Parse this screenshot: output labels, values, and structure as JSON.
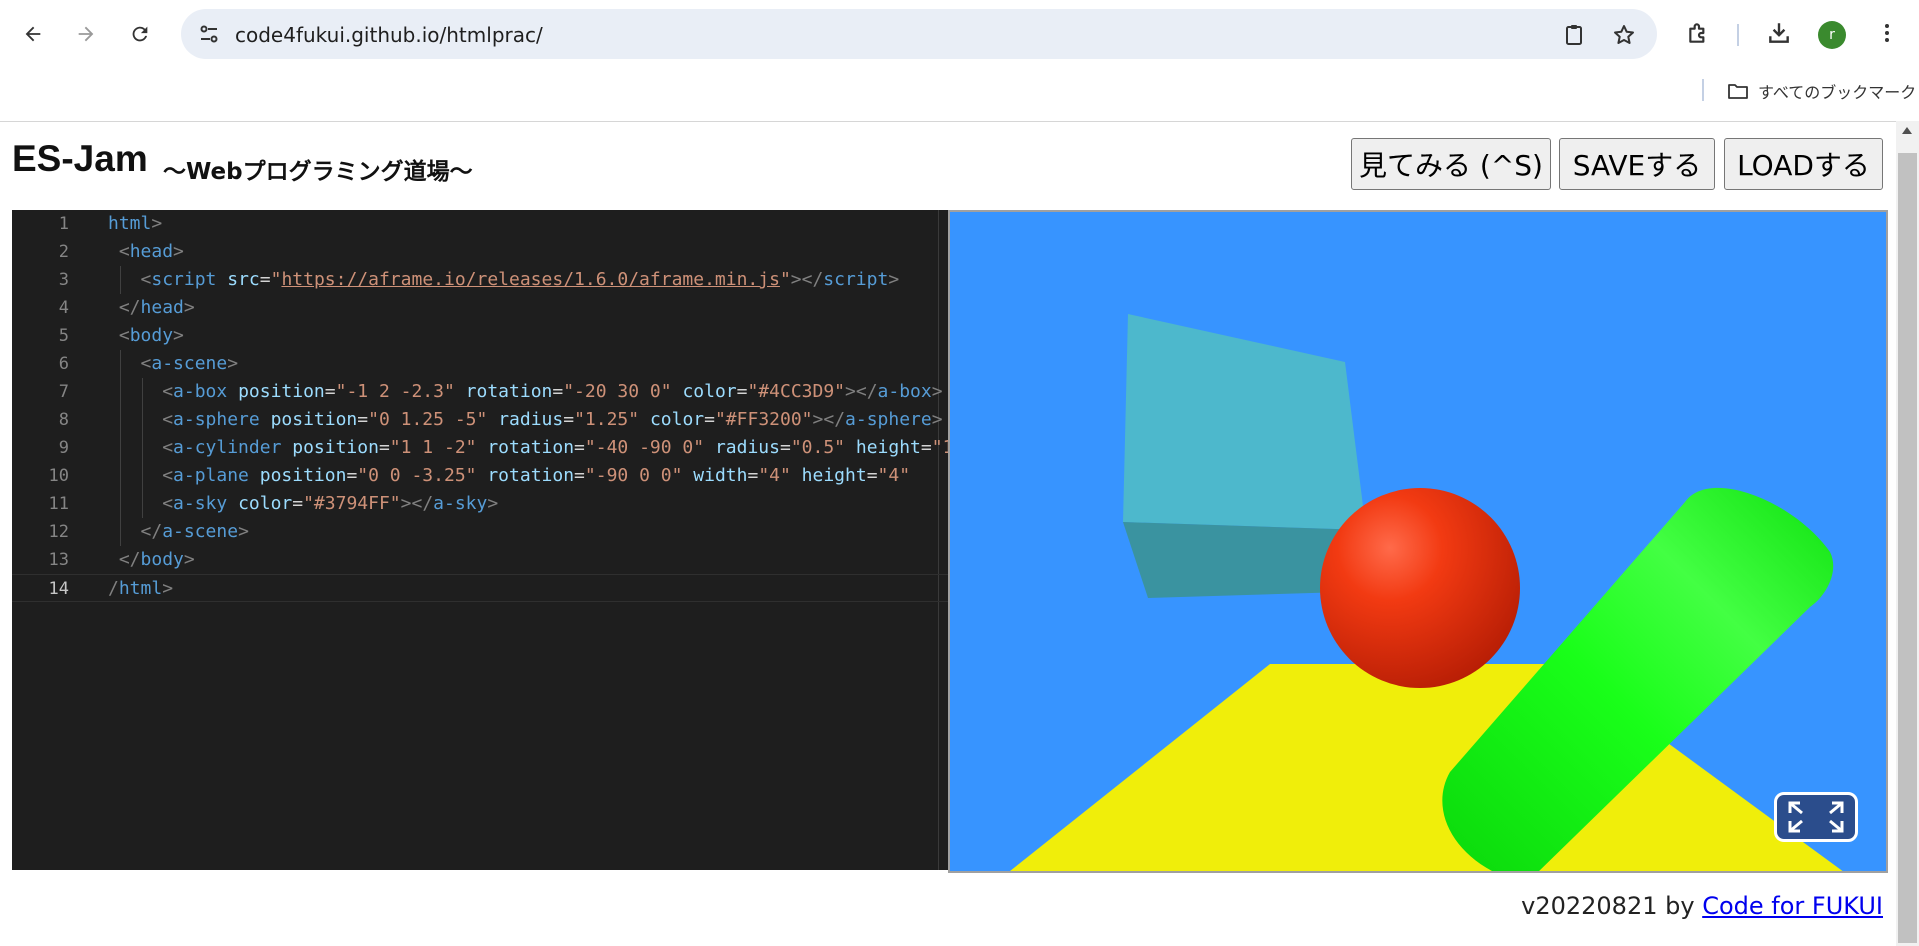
{
  "browser": {
    "url": "code4fukui.github.io/htmlprac/",
    "avatar_letter": "r",
    "bookmarks_all_label": "すべてのブックマーク"
  },
  "page": {
    "title": "ES-Jam",
    "subtitle": "〜Webプログラミング道場〜",
    "buttons": {
      "run_label": "見てみる (^S)",
      "save_label": "SAVEする",
      "load_label": "LOADする"
    }
  },
  "editor": {
    "line_numbers": [
      "1",
      "2",
      "3",
      "4",
      "5",
      "6",
      "7",
      "8",
      "9",
      "10",
      "11",
      "12",
      "13",
      "14"
    ],
    "current_line": "14"
  },
  "scene": {
    "sky_color": "#3794FF",
    "box_color": "#4CC3D9",
    "sphere_color": "#FF3200",
    "cylinder_color": "#00FF00",
    "plane_color": "#F0F000",
    "vr_button_icon": "fullscreen-icon"
  },
  "footer": {
    "version_text": "v20220821 by ",
    "link_text": "Code for FUKUI"
  }
}
